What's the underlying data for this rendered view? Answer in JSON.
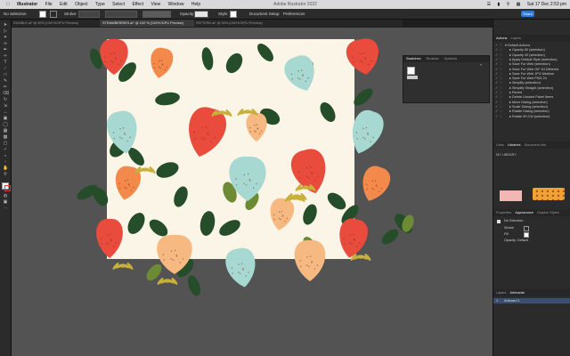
{
  "menubar": {
    "apple_icon": "apple-icon",
    "app": "Illustrator",
    "items": [
      "File",
      "Edit",
      "Object",
      "Type",
      "Select",
      "Effect",
      "View",
      "Window",
      "Help"
    ],
    "title": "Adobe Illustrator 2022",
    "clock": "Sat 17 Dec  2:53 pm",
    "status_icons": [
      "wifi-icon",
      "battery-icon",
      "search-icon",
      "control-center-icon"
    ]
  },
  "control": {
    "selection_label": "No Selection",
    "stroke_label": "Stroke:",
    "opacity_label": "Opacity:",
    "opacity_value": "100%",
    "style_label": "Style:",
    "doc_setup": "Document Setup",
    "preferences": "Preferences",
    "share": "Share"
  },
  "tabs": [
    {
      "label": "RUMBLE.ai* @ 50% (CMYK/GPU Preview)",
      "active": false
    },
    {
      "label": "STRAWBERRIES.ai* @ 100 % (CMYK/GPU Preview)",
      "active": true
    },
    {
      "label": "PATTERN.ai* @ 50% (CMYK/GPU Preview)",
      "active": false
    }
  ],
  "swatches_panel": {
    "tabs": [
      "Swatches",
      "Brushes",
      "Symbols"
    ],
    "active": "Swatches"
  },
  "layers_panel": {
    "tabs": [
      "Actions",
      "Layers"
    ],
    "active": "Actions",
    "rows": [
      "Default Actions",
      "Opacity 60 (selection)",
      "Opacity 40 (selection)",
      "Apply Default Style (selection)",
      "Save For Web (selection)",
      "Save For Web GIF 64 Dithered",
      "Save For Web JPG Medium",
      "Save For Web PNG 24",
      "Simplify (selection)",
      "Simplify Straight (selection)",
      "Revert",
      "Delete Unused Panel Items",
      "Move Dialog (selection)",
      "Scale Dialog (selection)",
      "Rotate Dialog (selection)",
      "Rotate 90 CW (selection)"
    ]
  },
  "libraries_panel": {
    "tabs": [
      "Links",
      "Libraries",
      "Document Info"
    ],
    "active": "Libraries",
    "group_label": "MY LIBRARY"
  },
  "appearance_panel": {
    "tabs": [
      "Properties",
      "Appearance",
      "Graphic Styles"
    ],
    "active": "Appearance",
    "title": "No Selection",
    "stroke_label": "Stroke",
    "fill_label": "Fill",
    "opacity_label": "Opacity: Default"
  },
  "layers_bottom": {
    "tabs": [
      "Layers",
      "Artboards"
    ],
    "active": "Artboards",
    "item": "Artboard 1",
    "index": "1"
  },
  "colors": {
    "accent": "#2f7ad9",
    "artboard_bg": "#faf5e6",
    "strawberry_red": "#e94b3c",
    "strawberry_orange": "#f38a4c",
    "strawberry_peach": "#f7b982",
    "strawberry_mint": "#a8d8d2",
    "leaf_dark": "#254d2a",
    "leaf_olive": "#6d8a34",
    "stem_yellow": "#c9b03a",
    "swatch_pink": "#f2b7b3",
    "swatch_orange": "#f0a236"
  }
}
